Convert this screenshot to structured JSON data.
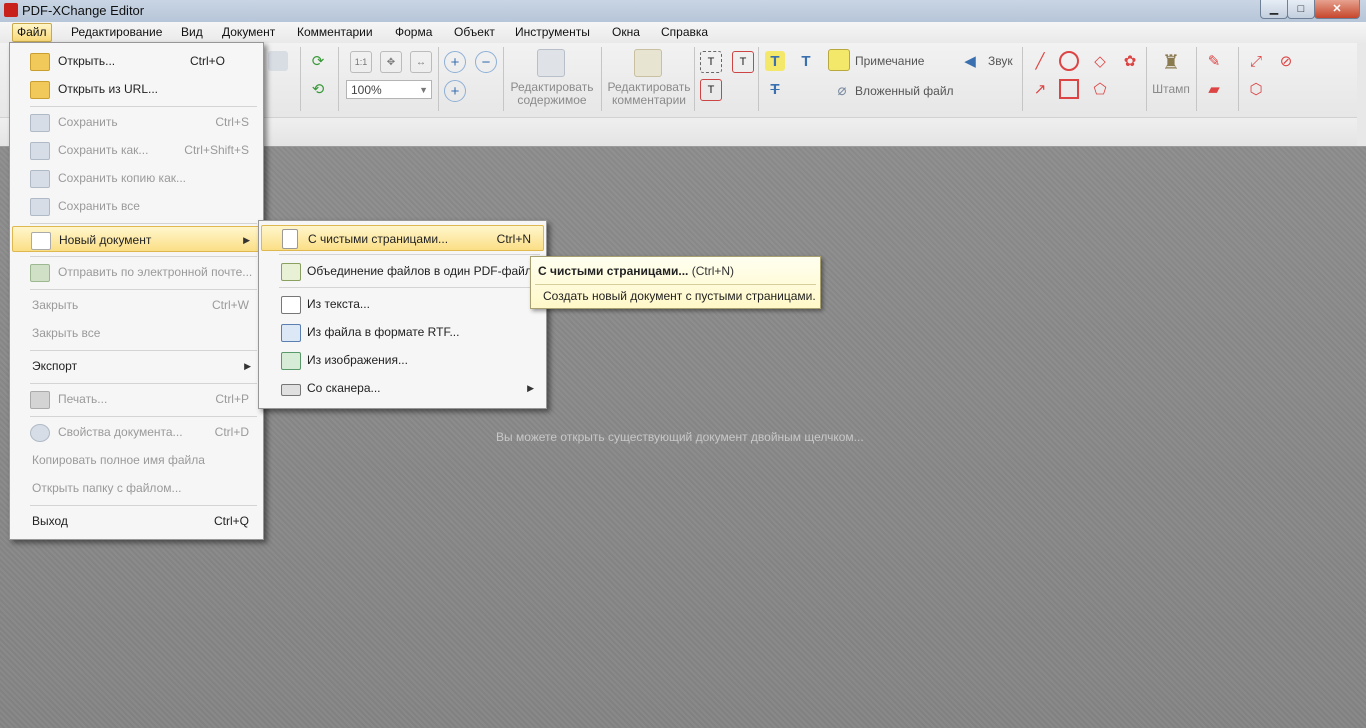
{
  "window": {
    "title": "PDF-XChange Editor",
    "min_glyph": "▁",
    "max_glyph": "□",
    "close_glyph": "✕"
  },
  "menubar": {
    "items": [
      "Файл",
      "Редактирование",
      "Вид",
      "Документ",
      "Комментарии",
      "Форма",
      "Объект",
      "Инструменты",
      "Окна",
      "Справка"
    ]
  },
  "toolbar": {
    "zoom_value": "100%",
    "edit_content_line1": "Редактировать",
    "edit_content_line2": "содержимое",
    "edit_comments_line1": "Редактировать",
    "edit_comments_line2": "комментарии",
    "note_label": "Примечание",
    "attached_file_label": "Вложенный файл",
    "sound_label": "Звук",
    "stamp_label": "Штамп",
    "fit_label": "1:1"
  },
  "file_menu": {
    "items": [
      {
        "label": "Открыть...",
        "shortcut": "Ctrl+O",
        "icon": "folder-open-icon",
        "enabled": true
      },
      {
        "label": "Открыть из URL...",
        "shortcut": "",
        "icon": "folder-url-icon",
        "enabled": true
      },
      {
        "label": "Сохранить",
        "shortcut": "Ctrl+S",
        "icon": "save-icon",
        "enabled": false
      },
      {
        "label": "Сохранить как...",
        "shortcut": "Ctrl+Shift+S",
        "icon": "save-as-icon",
        "enabled": false
      },
      {
        "label": "Сохранить копию как...",
        "shortcut": "",
        "icon": "save-copy-icon",
        "enabled": false
      },
      {
        "label": "Сохранить все",
        "shortcut": "",
        "icon": "save-all-icon",
        "enabled": false
      },
      {
        "label": "Новый документ",
        "shortcut": "",
        "icon": "new-document-icon",
        "enabled": true
      },
      {
        "label": "Отправить по электронной почте...",
        "shortcut": "",
        "icon": "email-icon",
        "enabled": false
      },
      {
        "label": "Закрыть",
        "shortcut": "Ctrl+W",
        "enabled": false
      },
      {
        "label": "Закрыть все",
        "shortcut": "",
        "enabled": false
      },
      {
        "label": "Экспорт",
        "shortcut": "",
        "enabled": true
      },
      {
        "label": "Печать...",
        "shortcut": "Ctrl+P",
        "icon": "print-icon",
        "enabled": false
      },
      {
        "label": "Свойства документа...",
        "shortcut": "Ctrl+D",
        "icon": "properties-icon",
        "enabled": false
      },
      {
        "label": "Копировать полное имя файла",
        "shortcut": "",
        "enabled": false
      },
      {
        "label": "Открыть папку с файлом...",
        "shortcut": "",
        "enabled": false
      },
      {
        "label": "Выход",
        "shortcut": "Ctrl+Q",
        "enabled": true
      }
    ]
  },
  "new_doc_submenu": {
    "items": [
      {
        "label": "С чистыми страницами...",
        "shortcut": "Ctrl+N",
        "icon": "blank-page-icon"
      },
      {
        "label": "Объединение файлов в один PDF-файл...",
        "shortcut": "",
        "icon": "combine-files-icon"
      },
      {
        "label": "Из текста...",
        "shortcut": "",
        "icon": "txt-file-icon"
      },
      {
        "label": "Из файла в формате RTF...",
        "shortcut": "",
        "icon": "rtf-file-icon"
      },
      {
        "label": "Из изображения...",
        "shortcut": "",
        "icon": "bmp-file-icon"
      },
      {
        "label": "Со сканера...",
        "shortcut": "",
        "icon": "scanner-icon"
      }
    ]
  },
  "tooltip": {
    "title": "С чистыми страницами...",
    "shortcut": "(Ctrl+N)",
    "description": "Создать новый документ с пустыми страницами."
  },
  "document_area": {
    "hint": "Вы можете открыть существующий документ двойным щелчком..."
  },
  "colors": {
    "highlight": "#fbdf86",
    "doc_background": "#878787",
    "close_button": "#c6462c"
  }
}
